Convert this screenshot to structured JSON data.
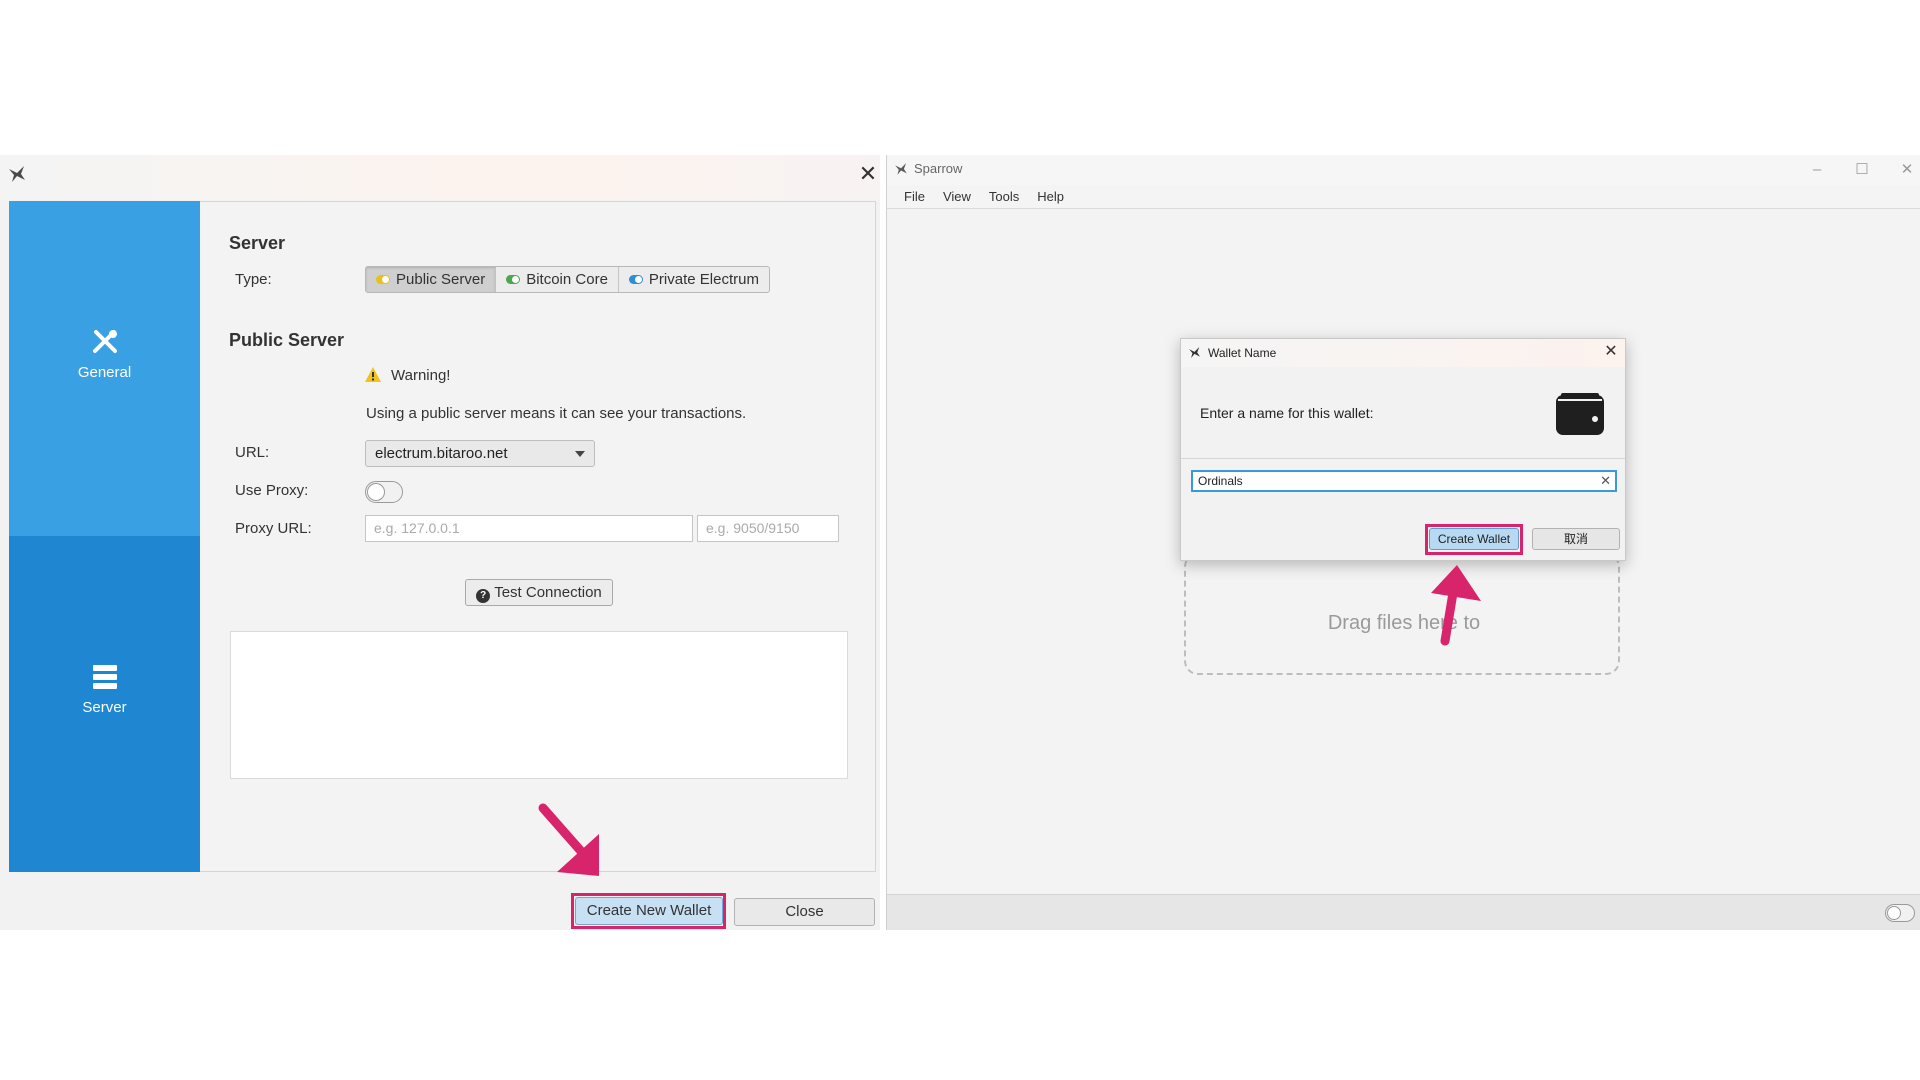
{
  "preferences": {
    "sidebar": {
      "items": [
        {
          "label": "General",
          "icon": "tools-icon"
        },
        {
          "label": "Server",
          "icon": "server-icon"
        }
      ]
    },
    "server_heading": "Server",
    "type_label": "Type:",
    "type_options": [
      {
        "label": "Public Server",
        "dot_color": "#e8c21a",
        "selected": true
      },
      {
        "label": "Bitcoin Core",
        "dot_color": "#4aa84a",
        "selected": false
      },
      {
        "label": "Private Electrum",
        "dot_color": "#2f8fd3",
        "selected": false
      }
    ],
    "public_server_heading": "Public Server",
    "warning_title": "Warning!",
    "warning_text": "Using a public server means it can see your transactions.",
    "url_label": "URL:",
    "url_value": "electrum.bitaroo.net",
    "use_proxy_label": "Use Proxy:",
    "use_proxy_on": false,
    "proxy_url_label": "Proxy URL:",
    "proxy_host_placeholder": "e.g. 127.0.0.1",
    "proxy_port_placeholder": "e.g. 9050/9150",
    "test_connection_label": "Test Connection",
    "create_new_wallet_label": "Create New Wallet",
    "close_label": "Close"
  },
  "sparrow": {
    "title": "Sparrow",
    "menu": [
      "File",
      "View",
      "Tools",
      "Help"
    ],
    "drop_text": "Drag files here to",
    "status_toggle_on": false
  },
  "wallet_dialog": {
    "title": "Wallet Name",
    "prompt": "Enter a name for this wallet:",
    "input_value": "Ordinals",
    "create_label": "Create Wallet",
    "cancel_label": "取消"
  },
  "colors": {
    "highlight": "#d8246b",
    "sidebar_active": "#39a0e4",
    "sidebar": "#1f86d2",
    "primary_button": "#c7e0f3"
  }
}
